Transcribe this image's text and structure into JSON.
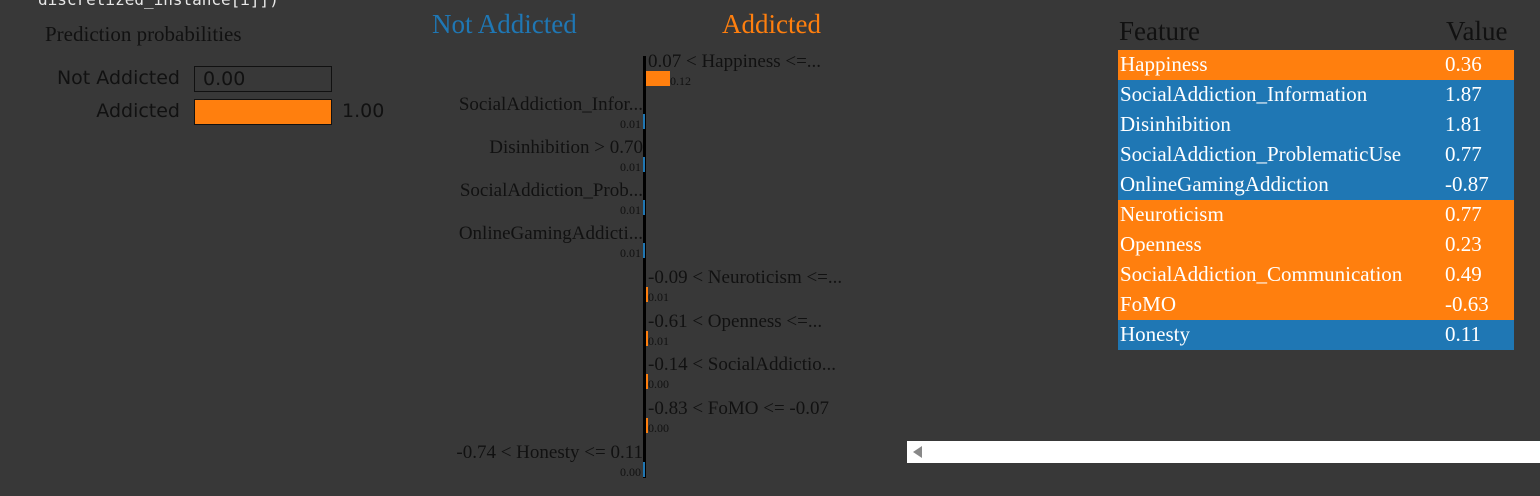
{
  "code_line": "discretized_instance[i]])",
  "prediction": {
    "title": "Prediction probabilities",
    "rows": [
      {
        "label": "Not Addicted",
        "value_text": "0.00",
        "value": 0.0
      },
      {
        "label": "Addicted",
        "value_text": "1.00",
        "value": 1.0
      }
    ]
  },
  "explanation": {
    "class_left": "Not Addicted",
    "class_right": "Addicted",
    "colors": {
      "left": "#1f77b4",
      "right": "#ff7f0e"
    },
    "features": [
      {
        "label": "0.07 < Happiness <=...",
        "weight_text": "0.12",
        "side": "right",
        "weight": 0.12
      },
      {
        "label": "SocialAddiction_Infor...",
        "weight_text": "0.01",
        "side": "left",
        "weight": 0.01
      },
      {
        "label": "Disinhibition > 0.70",
        "weight_text": "0.01",
        "side": "left",
        "weight": 0.01
      },
      {
        "label": "SocialAddiction_Prob...",
        "weight_text": "0.01",
        "side": "left",
        "weight": 0.01
      },
      {
        "label": "OnlineGamingAddicti...",
        "weight_text": "0.01",
        "side": "left",
        "weight": 0.01
      },
      {
        "label": "-0.09 < Neuroticism <=...",
        "weight_text": "0.01",
        "side": "right",
        "weight": 0.01
      },
      {
        "label": "-0.61 < Openness <=...",
        "weight_text": "0.01",
        "side": "right",
        "weight": 0.01
      },
      {
        "label": "-0.14 < SocialAddictio...",
        "weight_text": "0.00",
        "side": "right",
        "weight": 0.0
      },
      {
        "label": "-0.83 < FoMO <= -0.07",
        "weight_text": "0.00",
        "side": "right",
        "weight": 0.0
      },
      {
        "label": "-0.74 < Honesty <= 0.11",
        "weight_text": "0.00",
        "side": "left",
        "weight": 0.0
      }
    ]
  },
  "table": {
    "header_feature": "Feature",
    "header_value": "Value",
    "rows": [
      {
        "feature": "Happiness",
        "value": "0.36",
        "color": "#ff7f0e"
      },
      {
        "feature": "SocialAddiction_Information",
        "value": "1.87",
        "color": "#1f77b4"
      },
      {
        "feature": "Disinhibition",
        "value": "1.81",
        "color": "#1f77b4"
      },
      {
        "feature": "SocialAddiction_ProblematicUse",
        "value": "0.77",
        "color": "#1f77b4"
      },
      {
        "feature": "OnlineGamingAddiction",
        "value": "-0.87",
        "color": "#1f77b4"
      },
      {
        "feature": "Neuroticism",
        "value": "0.77",
        "color": "#ff7f0e"
      },
      {
        "feature": "Openness",
        "value": "0.23",
        "color": "#ff7f0e"
      },
      {
        "feature": "SocialAddiction_Communication",
        "value": "0.49",
        "color": "#ff7f0e"
      },
      {
        "feature": "FoMO",
        "value": "-0.63",
        "color": "#ff7f0e"
      },
      {
        "feature": "Honesty",
        "value": "0.11",
        "color": "#1f77b4"
      }
    ]
  }
}
